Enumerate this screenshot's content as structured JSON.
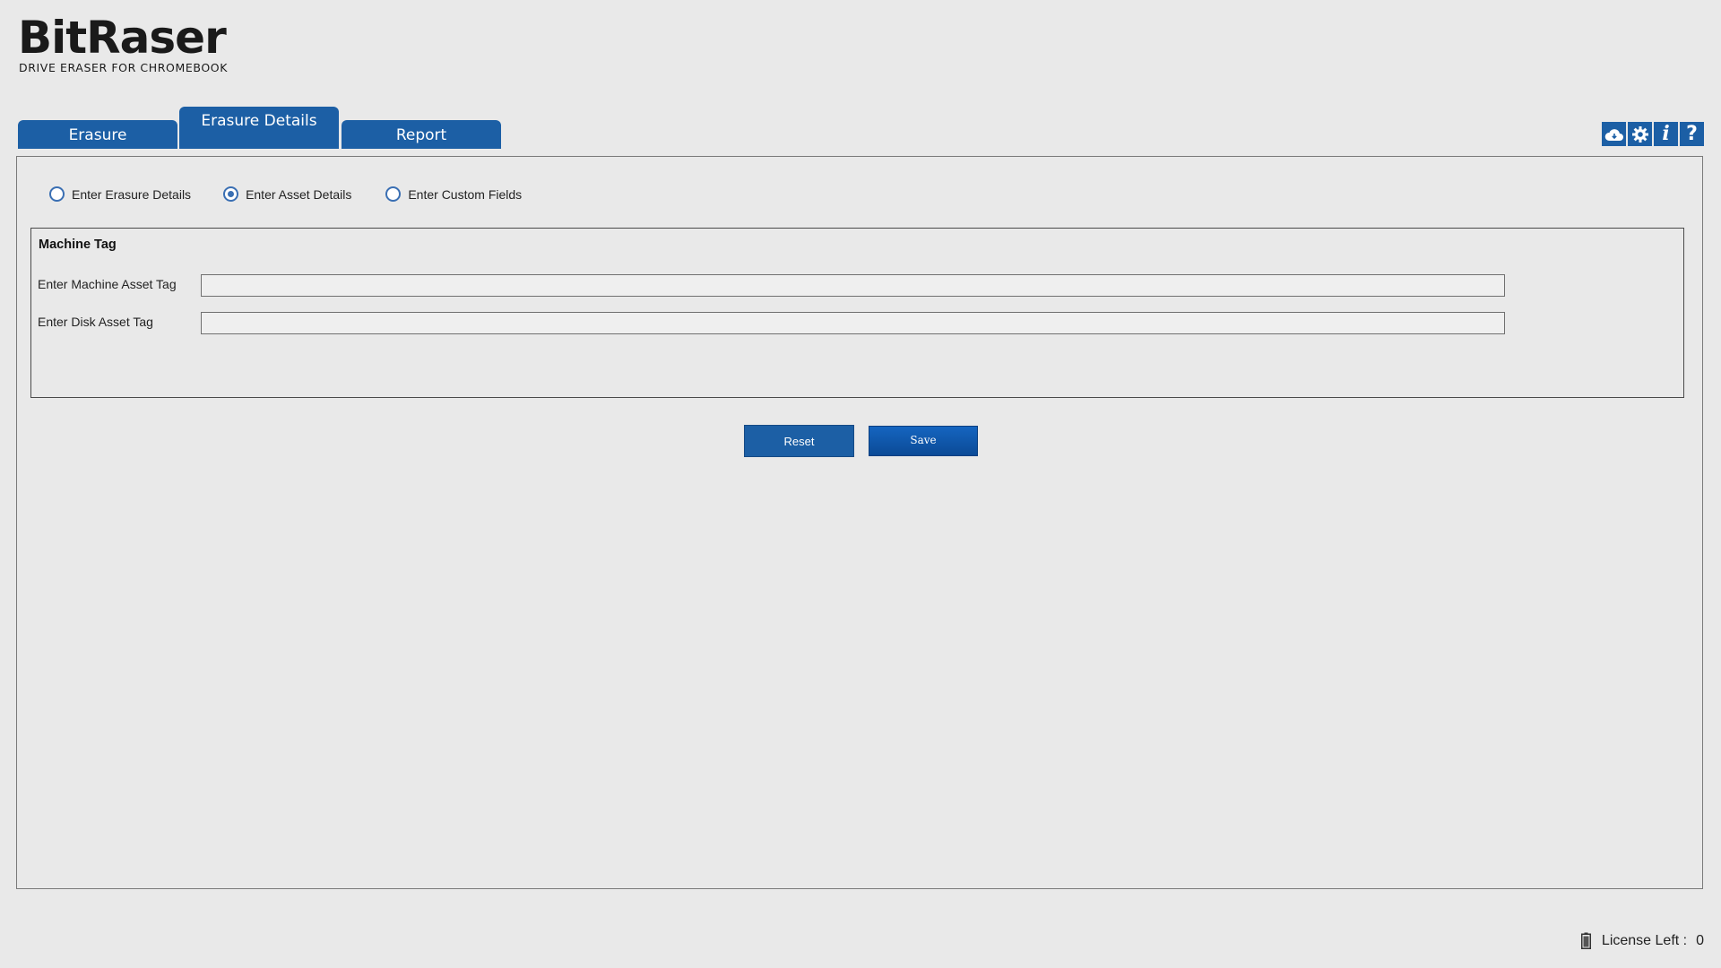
{
  "app": {
    "logo_title": "BitRaser",
    "logo_subtitle": "DRIVE ERASER FOR CHROMEBOOK"
  },
  "tabs": [
    {
      "label": "Erasure",
      "active": false
    },
    {
      "label": "Erasure Details",
      "active": true
    },
    {
      "label": "Report",
      "active": false
    }
  ],
  "top_icons": [
    "cloud-icon",
    "gear-icon",
    "info-icon",
    "help-icon"
  ],
  "top_icon_glyphs": {
    "info": "i",
    "help": "?"
  },
  "radios": [
    {
      "label": "Enter Erasure Details",
      "checked": false
    },
    {
      "label": "Enter Asset Details",
      "checked": true
    },
    {
      "label": "Enter Custom Fields",
      "checked": false
    }
  ],
  "machine_tag": {
    "title": "Machine Tag",
    "machine_asset_label": "Enter Machine Asset Tag",
    "machine_asset_value": "",
    "disk_asset_label": "Enter Disk Asset Tag",
    "disk_asset_value": ""
  },
  "buttons": {
    "reset_label": "Reset",
    "save_label": "Save"
  },
  "footer": {
    "license_label": "License Left :",
    "license_count": "0"
  },
  "colors": {
    "accent": "#1c5fa5",
    "background": "#e9e9e9"
  }
}
